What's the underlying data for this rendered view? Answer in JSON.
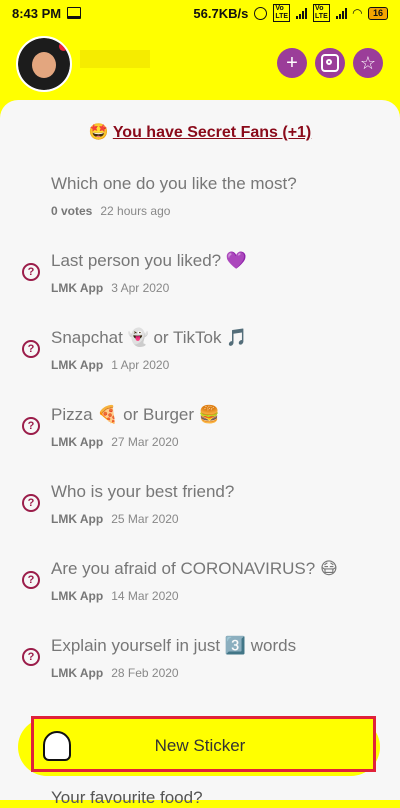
{
  "status_bar": {
    "time": "8:43 PM",
    "speed": "56.7KB/s",
    "battery": "16"
  },
  "header": {
    "add_icon": "plus-icon",
    "instagram_icon": "instagram-icon",
    "star_icon": "star-icon"
  },
  "banner": {
    "emoji": "🤩",
    "text": "You have Secret Fans (+1)"
  },
  "questions": [
    {
      "title": "Which one do you like the most?",
      "source": "0 votes",
      "date": "22 hours ago",
      "has_icon": false
    },
    {
      "title": "Last person you liked? 💜",
      "source": "LMK App",
      "date": "3 Apr 2020",
      "has_icon": true
    },
    {
      "title": "Snapchat 👻 or TikTok 🎵",
      "source": "LMK App",
      "date": "1 Apr 2020",
      "has_icon": true
    },
    {
      "title": "Pizza 🍕 or Burger 🍔",
      "source": "LMK App",
      "date": "27 Mar 2020",
      "has_icon": true
    },
    {
      "title": "Who is your best friend?",
      "source": "LMK App",
      "date": "25 Mar 2020",
      "has_icon": true
    },
    {
      "title": "Are you afraid of CORONAVIRUS? 😷",
      "source": "LMK App",
      "date": "14 Mar 2020",
      "has_icon": true
    },
    {
      "title": "Explain yourself in just 3️⃣ words",
      "source": "LMK App",
      "date": "28 Feb 2020",
      "has_icon": true
    }
  ],
  "bottom": {
    "button_label": "New Sticker",
    "partial_question": "Your favourite food?"
  }
}
